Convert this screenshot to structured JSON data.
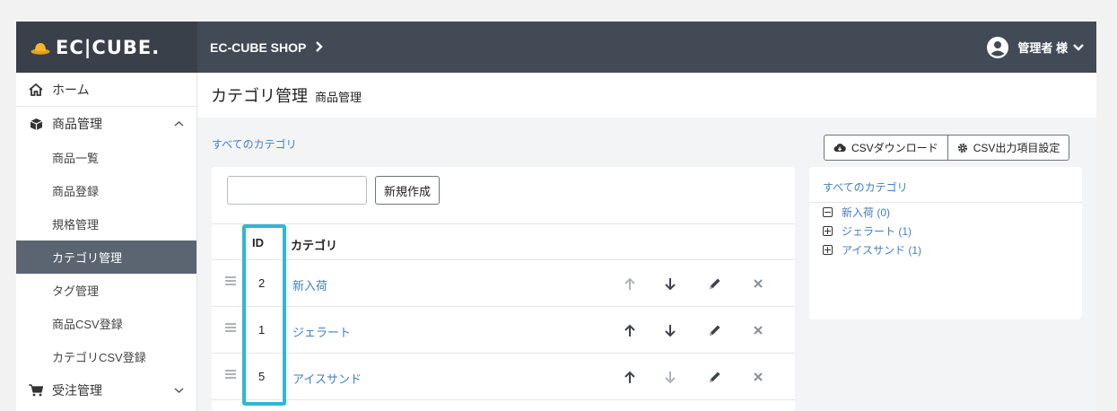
{
  "header": {
    "logo_text": "EC|CUBE.",
    "shop_name": "EC-CUBE SHOP",
    "user_name": "管理者 様"
  },
  "sidebar": {
    "home": "ホーム",
    "product_group": "商品管理",
    "items": [
      {
        "label": "商品一覧",
        "active": false
      },
      {
        "label": "商品登録",
        "active": false
      },
      {
        "label": "規格管理",
        "active": false
      },
      {
        "label": "カテゴリ管理",
        "active": true
      },
      {
        "label": "タグ管理",
        "active": false
      },
      {
        "label": "商品CSV登録",
        "active": false
      },
      {
        "label": "カテゴリCSV登録",
        "active": false
      }
    ],
    "order_group": "受注管理"
  },
  "page": {
    "title": "カテゴリ管理",
    "subtitle": "商品管理",
    "breadcrumb": "すべてのカテゴリ",
    "csv_download": "CSVダウンロード",
    "csv_settings": "CSV出力項目設定",
    "new_placeholder": "",
    "new_button": "新規作成"
  },
  "table": {
    "headers": {
      "id": "ID",
      "category": "カテゴリ"
    },
    "rows": [
      {
        "id": "2",
        "name": "新入荷"
      },
      {
        "id": "1",
        "name": "ジェラート"
      },
      {
        "id": "5",
        "name": "アイスサンド"
      }
    ]
  },
  "tree": {
    "title": "すべてのカテゴリ",
    "items": [
      {
        "label": "新入荷 (0)",
        "expanded": true
      },
      {
        "label": "ジェラート (1)",
        "expanded": false
      },
      {
        "label": "アイスサンド (1)",
        "expanded": false
      }
    ]
  },
  "colors": {
    "header_bg": "#414a55",
    "sidebar_active": "#5b6572",
    "link": "#437ec4",
    "highlight": "#33b5d8"
  }
}
